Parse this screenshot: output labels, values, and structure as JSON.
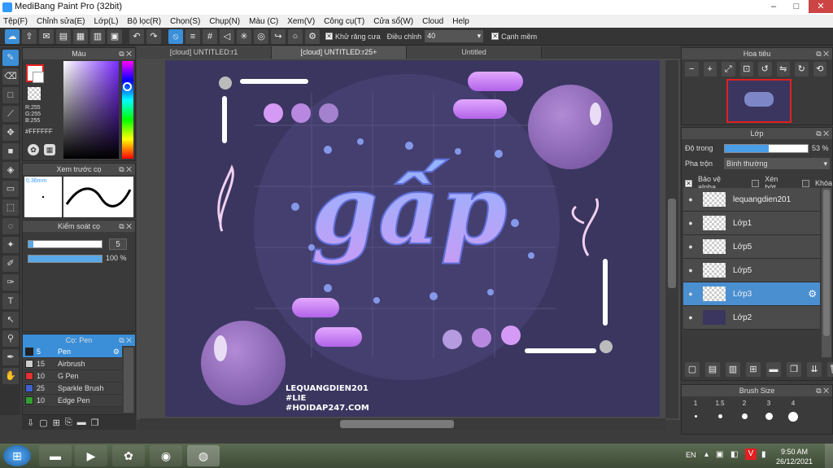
{
  "window": {
    "title": "MediBang Paint Pro (32bit)",
    "min": "–",
    "max": "□",
    "close": "✕"
  },
  "menu": [
    "Tệp(F)",
    "Chỉnh sửa(E)",
    "Lớp(L)",
    "Bộ lọc(R)",
    "Chọn(S)",
    "Chụp(N)",
    "Màu (C)",
    "Xem(V)",
    "Công cụ(T)",
    "Cửa sổ(W)",
    "Cloud",
    "Help"
  ],
  "toolbar": {
    "antialias_label": "Khử răng cưa",
    "adjust_label": "Điều chỉnh",
    "adjust_value": "40",
    "snap_label": "Cạnh mềm"
  },
  "color_panel": {
    "title": "Màu",
    "r": "R:255",
    "g": "G:255",
    "b": "B:255",
    "hex": "#FFFFFF"
  },
  "preview_panel": {
    "title": "Xem trước cọ",
    "size": "0.36mm"
  },
  "brush_control": {
    "title": "Kiểm soát cọ",
    "size_value": "5",
    "opacity_value": "100 %",
    "opacity": 1.0
  },
  "brush_panel": {
    "title": "Cọ: Pen",
    "items": [
      {
        "size": "5",
        "name": "Pen",
        "color": "#222222"
      },
      {
        "size": "15",
        "name": "Airbrush",
        "color": "#cccccc"
      },
      {
        "size": "10",
        "name": "G Pen",
        "color": "#e03030"
      },
      {
        "size": "25",
        "name": "Sparkle Brush",
        "color": "#4060d0"
      },
      {
        "size": "10",
        "name": "Edge Pen",
        "color": "#30a030"
      }
    ]
  },
  "tabs": [
    "[cloud] UNTITLED:r1",
    "[cloud] UNTITLED:r25+",
    "Untitled"
  ],
  "artwork": {
    "big_text": "gấp",
    "watermark": [
      "LEQUANGDIEN201",
      "#LIE",
      "#HOIDAP247.COM"
    ],
    "bg_color": "#3a3660"
  },
  "navigator": {
    "title": "Hoa tiêu"
  },
  "layers_panel": {
    "title": "Lớp",
    "opacity_label": "Độ trong",
    "opacity_value": "53 %",
    "opacity": 0.53,
    "blend_label": "Pha trộn",
    "blend_value": "Bình thường",
    "protect_alpha": "Bảo vệ alpha",
    "clipping": "Xén bớt",
    "lock": "Khóa",
    "layers": [
      "lequangdien201",
      "Lớp1",
      "Lớp5",
      "Lớp5",
      "Lớp3",
      "Lớp2"
    ],
    "selected_index": 4
  },
  "brush_size_panel": {
    "title": "Brush Size",
    "sizes": [
      "1",
      "1.5",
      "2",
      "3",
      "4"
    ]
  },
  "taskbar": {
    "lang": "EN",
    "time": "9:50 AM",
    "date": "26/12/2021"
  }
}
